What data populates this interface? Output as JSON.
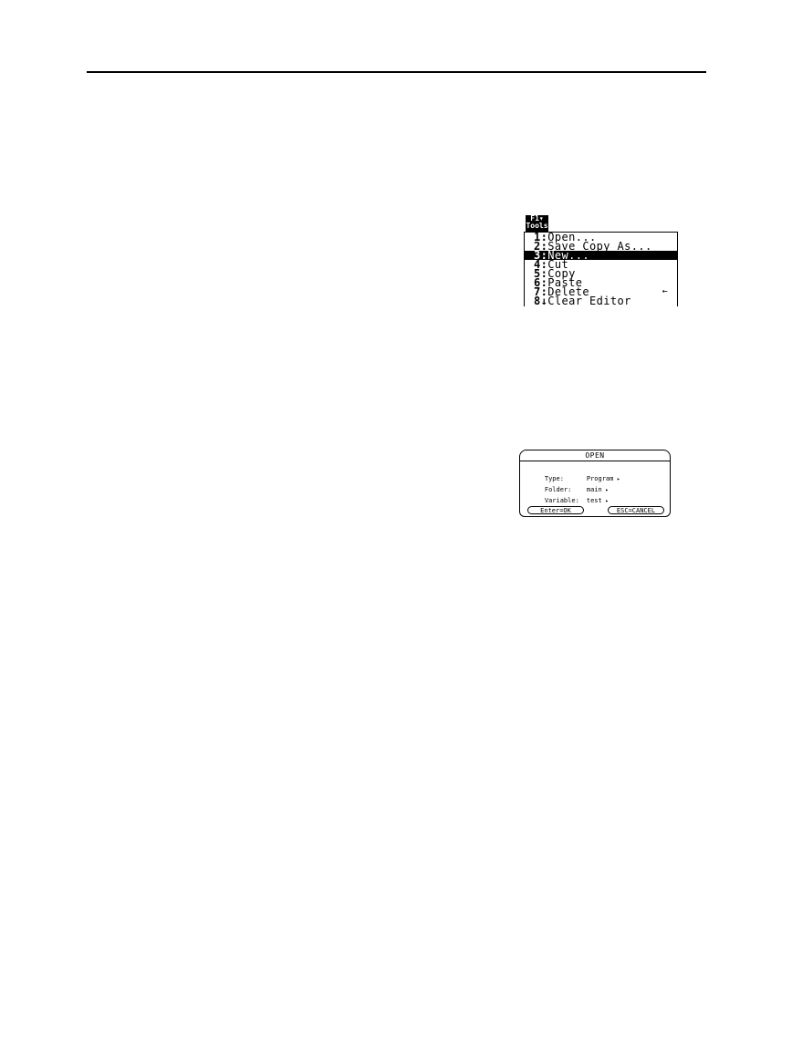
{
  "tools_menu": {
    "tab_line1": "F1▾",
    "tab_line2": "Tools",
    "items": [
      {
        "num": "1:",
        "label": "Open..."
      },
      {
        "num": "2:",
        "label": "Save Copy As..."
      },
      {
        "num": "3:",
        "label": "New..."
      },
      {
        "num": "4:",
        "label": "Cut"
      },
      {
        "num": "5:",
        "label": "Copy"
      },
      {
        "num": "6:",
        "label": "Paste"
      },
      {
        "num": "7:",
        "label": "Delete"
      },
      {
        "num": "8↓",
        "label": "Clear Editor"
      }
    ],
    "selected_index": 2,
    "delete_shortcut_icon": "←"
  },
  "open_dialog": {
    "title": "OPEN",
    "type_label": "Type:",
    "type_value": "Program",
    "folder_label": "Folder:",
    "folder_value": "main",
    "variable_label": "Variable:",
    "variable_value": "test",
    "ok_label": "Enter=OK",
    "cancel_label": "ESC=CANCEL"
  }
}
